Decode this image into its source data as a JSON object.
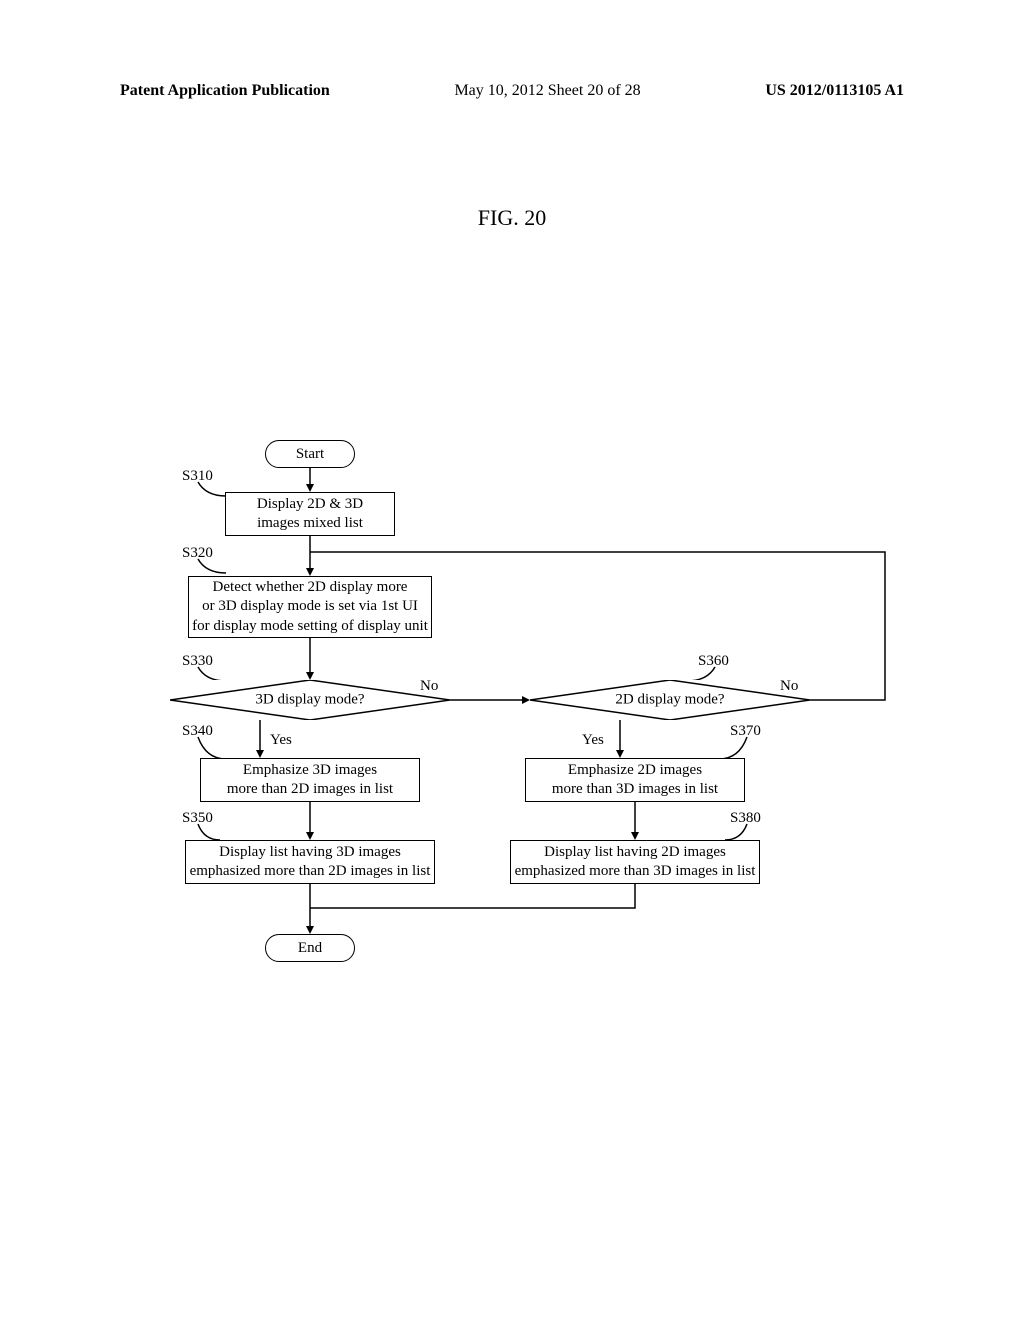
{
  "header": {
    "left": "Patent Application Publication",
    "center": "May 10, 2012  Sheet 20 of 28",
    "right": "US 2012/0113105 A1"
  },
  "fig_title": "FIG. 20",
  "flowchart": {
    "start": "Start",
    "end": "End",
    "s310": {
      "label": "S310",
      "text": "Display 2D & 3D\nimages mixed list"
    },
    "s320": {
      "label": "S320",
      "text": "Detect whether 2D display more\nor 3D display mode is set via 1st UI\nfor display mode setting of display unit"
    },
    "s330": {
      "label": "S330",
      "text": "3D display mode?"
    },
    "s340": {
      "label": "S340",
      "text": "Emphasize 3D images\nmore than 2D images in list"
    },
    "s350": {
      "label": "S350",
      "text": "Display list having 3D images\nemphasized more than 2D images in list"
    },
    "s360": {
      "label": "S360",
      "text": "2D display mode?"
    },
    "s370": {
      "label": "S370",
      "text": "Emphasize 2D images\nmore than 3D images in list"
    },
    "s380": {
      "label": "S380",
      "text": "Display list having 2D images\nemphasized more than 3D images in list"
    },
    "edges": {
      "yes": "Yes",
      "no": "No"
    }
  }
}
